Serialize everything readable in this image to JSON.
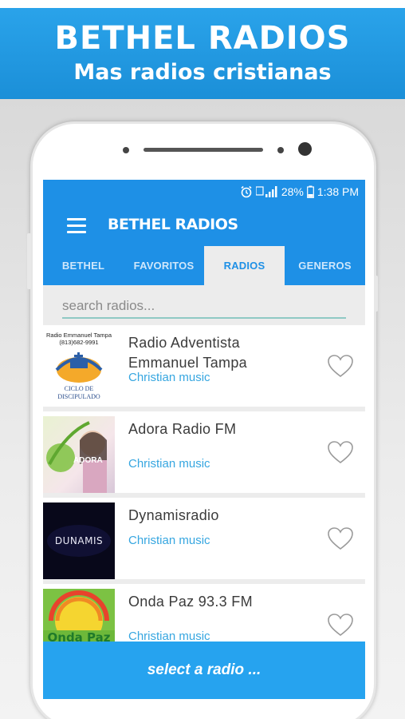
{
  "banner": {
    "title": "BETHEL RADIOS",
    "subtitle": "Mas radios cristianas"
  },
  "statusbar": {
    "battery": "28%",
    "time": "1:38 PM",
    "icons": [
      "alarm-icon",
      "signal-icon",
      "battery-icon"
    ]
  },
  "app": {
    "title": "BETHEL RADIOS",
    "menu_icon": "hamburger-menu-icon"
  },
  "tabs": [
    {
      "label": "BETHEL",
      "active": false
    },
    {
      "label": "FAVORITOS",
      "active": false
    },
    {
      "label": "RADIOS",
      "active": true
    },
    {
      "label": "GENEROS",
      "active": false
    }
  ],
  "search": {
    "placeholder": "search radios...",
    "value": ""
  },
  "stations": [
    {
      "name": "Radio Adventista Emmanuel Tampa",
      "genre": "Christian music",
      "favorite_icon": "heart-outline-icon",
      "logo_text": [
        "Radio Emmanuel Tampa",
        "(813)682-9991",
        "CICLO DE",
        "DISCIPULADO"
      ]
    },
    {
      "name": "Adora Radio FM",
      "genre": "Christian music",
      "favorite_icon": "heart-outline-icon",
      "logo_text": [
        "ADORA"
      ]
    },
    {
      "name": "Dynamisradio",
      "genre": "Christian music",
      "favorite_icon": "heart-outline-icon",
      "logo_text": [
        "DUNAMIS"
      ]
    },
    {
      "name": "Onda Paz 93.3 FM",
      "genre": "Christian music",
      "favorite_icon": "heart-outline-icon",
      "logo_text": [
        "Onda Paz"
      ]
    }
  ],
  "bottom_bar": {
    "label": "select a radio ..."
  },
  "colors": {
    "primary": "#1e90e6",
    "accent": "#36a6e0",
    "bottom_bar": "#26a3ef"
  }
}
